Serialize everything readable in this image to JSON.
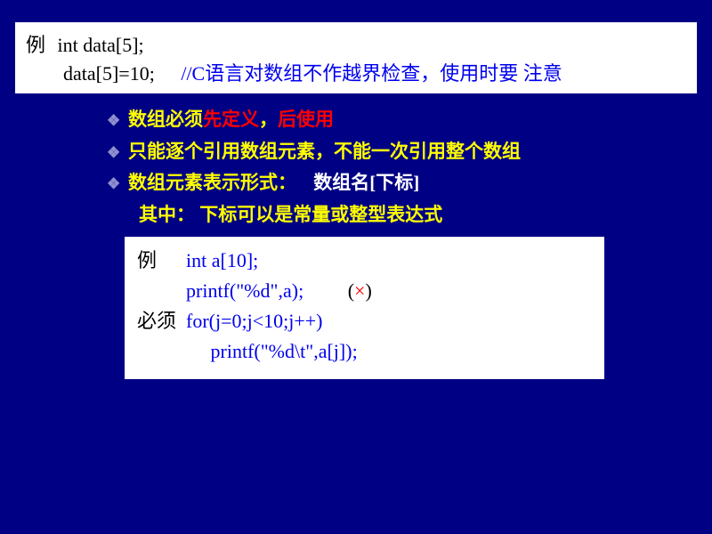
{
  "topbox": {
    "label": "例",
    "code1": "int data[5];",
    "code2": "data[5]=10;",
    "comment": "//C语言对数组不作越界检查，使用时要 注意"
  },
  "bullets": {
    "b1_part1": "数组必须",
    "b1_red1": "先定义",
    "b1_comma": "，",
    "b1_red2": "后使用",
    "b2": "只能逐个引用数组元素，不能一次引用整个数组",
    "b3_part1": "数组元素表示形式：",
    "b3_white": "数组名[下标]",
    "b3_sub": "其中：  下标可以是常量或整型表达式"
  },
  "bottombox": {
    "label1": "例",
    "code_line1": "int a[10];",
    "code_line2": "printf(\"%d\",a);",
    "wrong_paren_open": "(",
    "wrong_cross": "×",
    "wrong_paren_close": ")",
    "label2": "必须",
    "code_line3": "for(j=0;j<10;j++)",
    "code_line4": "     printf(\"%d\\t\",a[j]);"
  }
}
